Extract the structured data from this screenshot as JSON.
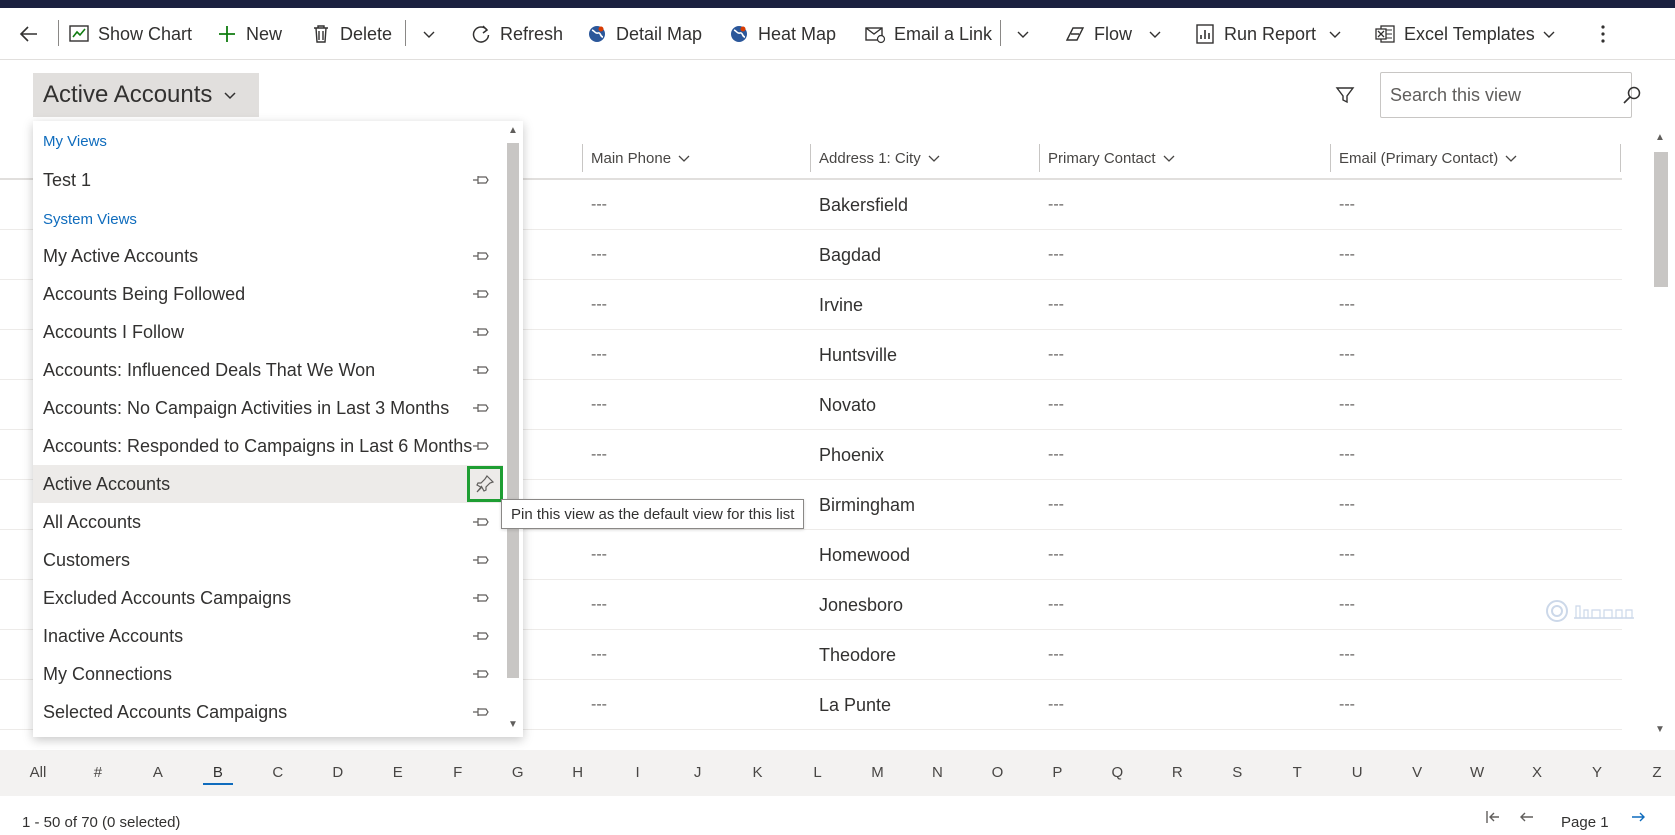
{
  "commands": {
    "back": "back",
    "show_chart": "Show Chart",
    "new": "New",
    "delete": "Delete",
    "refresh": "Refresh",
    "detail_map": "Detail Map",
    "heat_map": "Heat Map",
    "email_link": "Email a Link",
    "flow": "Flow",
    "run_report": "Run Report",
    "excel_templates": "Excel Templates"
  },
  "view_selector": {
    "label": "Active Accounts"
  },
  "search": {
    "placeholder": "Search this view"
  },
  "columns": [
    "Main Phone",
    "Address 1: City",
    "Primary Contact",
    "Email (Primary Contact)"
  ],
  "rows": [
    {
      "phone": "---",
      "city": "Bakersfield",
      "contact": "---",
      "email": "---"
    },
    {
      "phone": "---",
      "city": "Bagdad",
      "contact": "---",
      "email": "---"
    },
    {
      "phone": "---",
      "city": "Irvine",
      "contact": "---",
      "email": "---"
    },
    {
      "phone": "---",
      "city": "Huntsville",
      "contact": "---",
      "email": "---"
    },
    {
      "phone": "---",
      "city": "Novato",
      "contact": "---",
      "email": "---"
    },
    {
      "phone": "---",
      "city": "Phoenix",
      "contact": "---",
      "email": "---"
    },
    {
      "phone": "---",
      "city": "Birmingham",
      "contact": "---",
      "email": "---"
    },
    {
      "phone": "---",
      "city": "Homewood",
      "contact": "---",
      "email": "---"
    },
    {
      "phone": "---",
      "city": "Jonesboro",
      "contact": "---",
      "email": "---"
    },
    {
      "phone": "---",
      "city": "Theodore",
      "contact": "---",
      "email": "---"
    },
    {
      "phone": "---",
      "city": "La Punte",
      "contact": "---",
      "email": "---"
    }
  ],
  "dropdown": {
    "my_views_label": "My Views",
    "my_views": [
      "Test 1"
    ],
    "system_views_label": "System Views",
    "system_views": [
      "My Active Accounts",
      "Accounts Being Followed",
      "Accounts I Follow",
      "Accounts: Influenced Deals That We Won",
      "Accounts: No Campaign Activities in Last 3 Months",
      "Accounts: Responded to Campaigns in Last 6 Months",
      "Active Accounts",
      "All Accounts",
      "Customers",
      "Excluded Accounts Campaigns",
      "Inactive Accounts",
      "My Connections",
      "Selected Accounts Campaigns"
    ],
    "selected": "Active Accounts"
  },
  "tooltip": "Pin this view as the default view for this list",
  "jump_letters": [
    "All",
    "#",
    "A",
    "B",
    "C",
    "D",
    "E",
    "F",
    "G",
    "H",
    "I",
    "J",
    "K",
    "L",
    "M",
    "N",
    "O",
    "P",
    "Q",
    "R",
    "S",
    "T",
    "U",
    "V",
    "W",
    "X",
    "Y",
    "Z"
  ],
  "jump_active": "B",
  "status": "1 - 50 of 70 (0 selected)",
  "page": "Page 1",
  "colors": {
    "accent": "#0f6cbd",
    "highlight": "#1e9e33",
    "topbar": "#1b2140",
    "green_icon": "#107c10"
  }
}
